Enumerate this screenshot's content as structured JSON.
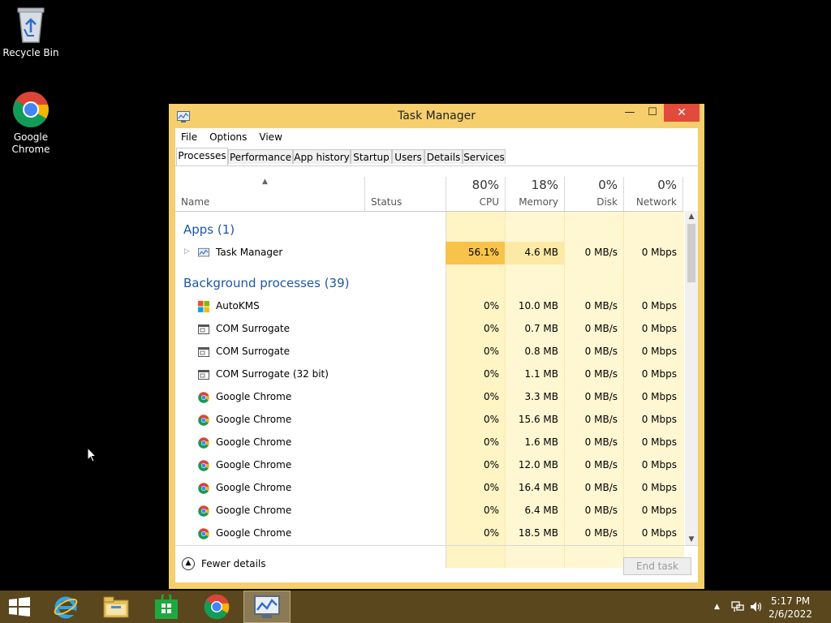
{
  "desktop": {
    "icons": [
      {
        "label": "Recycle Bin",
        "icon": "recycle-bin-icon"
      },
      {
        "label": "Google Chrome",
        "icon": "chrome-icon"
      }
    ]
  },
  "window": {
    "title": "Task Manager",
    "controls": {
      "minimize": "—",
      "maximize": "☐",
      "close": "✕"
    },
    "menu": [
      "File",
      "Options",
      "View"
    ],
    "tabs": [
      "Processes",
      "Performance",
      "App history",
      "Startup",
      "Users",
      "Details",
      "Services"
    ],
    "active_tab": "Processes",
    "columns": {
      "name": "Name",
      "status": "Status",
      "cpu": {
        "pct": "80%",
        "label": "CPU"
      },
      "memory": {
        "pct": "18%",
        "label": "Memory"
      },
      "disk": {
        "pct": "0%",
        "label": "Disk"
      },
      "network": {
        "pct": "0%",
        "label": "Network"
      }
    },
    "sections": {
      "apps": "Apps (1)",
      "background": "Background processes (39)"
    },
    "apps": [
      {
        "name": "Task Manager",
        "cpu": "56.1%",
        "memory": "4.6 MB",
        "disk": "0 MB/s",
        "network": "0 Mbps",
        "icon": "task-manager-icon"
      }
    ],
    "background": [
      {
        "name": "AutoKMS",
        "cpu": "0%",
        "memory": "10.0 MB",
        "disk": "0 MB/s",
        "network": "0 Mbps",
        "icon": "windows-logo-icon"
      },
      {
        "name": "COM Surrogate",
        "cpu": "0%",
        "memory": "0.7 MB",
        "disk": "0 MB/s",
        "network": "0 Mbps",
        "icon": "window-process-icon"
      },
      {
        "name": "COM Surrogate",
        "cpu": "0%",
        "memory": "0.8 MB",
        "disk": "0 MB/s",
        "network": "0 Mbps",
        "icon": "window-process-icon"
      },
      {
        "name": "COM Surrogate (32 bit)",
        "cpu": "0%",
        "memory": "1.1 MB",
        "disk": "0 MB/s",
        "network": "0 Mbps",
        "icon": "window-process-icon"
      },
      {
        "name": "Google Chrome",
        "cpu": "0%",
        "memory": "3.3 MB",
        "disk": "0 MB/s",
        "network": "0 Mbps",
        "icon": "chrome-icon"
      },
      {
        "name": "Google Chrome",
        "cpu": "0%",
        "memory": "15.6 MB",
        "disk": "0 MB/s",
        "network": "0 Mbps",
        "icon": "chrome-icon"
      },
      {
        "name": "Google Chrome",
        "cpu": "0%",
        "memory": "1.6 MB",
        "disk": "0 MB/s",
        "network": "0 Mbps",
        "icon": "chrome-icon"
      },
      {
        "name": "Google Chrome",
        "cpu": "0%",
        "memory": "12.0 MB",
        "disk": "0 MB/s",
        "network": "0 Mbps",
        "icon": "chrome-icon"
      },
      {
        "name": "Google Chrome",
        "cpu": "0%",
        "memory": "16.4 MB",
        "disk": "0 MB/s",
        "network": "0 Mbps",
        "icon": "chrome-icon"
      },
      {
        "name": "Google Chrome",
        "cpu": "0%",
        "memory": "6.4 MB",
        "disk": "0 MB/s",
        "network": "0 Mbps",
        "icon": "chrome-icon"
      },
      {
        "name": "Google Chrome",
        "cpu": "0%",
        "memory": "18.5 MB",
        "disk": "0 MB/s",
        "network": "0 Mbps",
        "icon": "chrome-icon"
      }
    ],
    "footer": {
      "fewer_details": "Fewer details",
      "end_task": "End task"
    }
  },
  "taskbar": {
    "pinned": [
      "start-windows-icon",
      "internet-explorer-icon",
      "file-explorer-icon",
      "store-icon",
      "chrome-icon",
      "task-manager-icon"
    ],
    "clock": {
      "time": "5:17 PM",
      "date": "2/6/2022"
    }
  },
  "colors": {
    "window_frame": "#f6cf6c",
    "close_button": "#e24a3b",
    "section_text": "#1e57a6",
    "cpu_highlight": "#f8c34a",
    "taskbar": "#5a471e"
  }
}
